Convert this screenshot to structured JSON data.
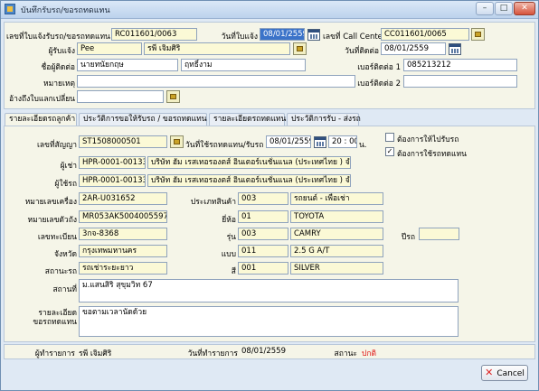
{
  "window": {
    "title": "บันทึกรับรถ/ขอรถทดแทน",
    "minimize_icon": "minimize-icon",
    "maximize_icon": "maximize-icon",
    "close_icon": "close-icon"
  },
  "top": {
    "notice_no_label": "เลขที่ใบแจ้งรับรถ/ขอรถทดแทน",
    "notice_no": "RC011601/0063",
    "notice_date_label": "วันที่ใบแจ้ง",
    "notice_date": "08/01/2559",
    "callcenter_label": "เลขที่ Call Center",
    "callcenter_no": "CC011601/0065",
    "informer_label": "ผู้รับแจ้ง",
    "informer_code": "Pee",
    "informer_name": "รพี เจิมศิริ",
    "contact_date_label": "วันที่ติดต่อ",
    "contact_date": "08/01/2559",
    "contact_name_label": "ชื่อผู้ติดต่อ",
    "contact_title": "นายทนัยกฤษ",
    "contact_lastname": "ฤทธิ์งาม",
    "phone1_label": "เบอร์ติดต่อ 1",
    "phone1": "085213212",
    "remark_label": "หมายเหตุ",
    "remark": "",
    "phone2_label": "เบอร์ติดต่อ 2",
    "phone2": "",
    "ref_label": "อ้างถึงใบแลกเปลี่ยน",
    "ref": ""
  },
  "tabs": [
    {
      "label": "รายละเอียดรถลูกค้า"
    },
    {
      "label": "ประวัติการขอให้รับรถ / ขอรถทดแทน"
    },
    {
      "label": "รายละเอียดรถทดแทน"
    },
    {
      "label": "ประวัติการรับ - ส่งรถ"
    }
  ],
  "detail": {
    "contract_label": "เลขที่สัญญา",
    "contract_no": "ST1508000501",
    "use_date_label": "วันที่ใช้รถทดแทน/รับรถ",
    "use_date": "08/01/2559",
    "hour": "20",
    "minute": "00",
    "time_unit": "น.",
    "chk_pickup_label": "ต้องการให้ไปรับรถ",
    "chk_pickup_mark": "",
    "chk_replace_label": "ต้องการใช้รถทดแทน",
    "chk_replace_mark": "✓",
    "renter_label": "ผู้เช่า",
    "renter_code": "HPR-0001-00133",
    "renter_name": "บริษัท ฮัม เรสเทอรองตส์ อินเตอร์เนชั่นแนล (ประเทศไทย ) จำกัด",
    "user_label": "ผู้ใช้รถ",
    "user_code": "HPR-0001-00133",
    "user_name": "บริษัท ฮัม เรสเทอรองตส์ อินเตอร์เนชั่นแนล (ประเทศไทย ) จำกัด",
    "engine_label": "หมายเลขเครื่อง",
    "engine": "2AR-U031652",
    "type_label": "ประเภทสินค้า",
    "type_code": "003",
    "type_name": "รถยนต์ - เพื่อเช่า",
    "chassis_label": "หมายเลขตัวถัง",
    "chassis": "MR053AK5004005597",
    "brand_label": "ยี่ห้อ",
    "brand_code": "01",
    "brand_name": "TOYOTA",
    "plate_label": "เลขทะเบียน",
    "plate": "3กจ-8368",
    "model_label": "รุ่น",
    "model_code": "003",
    "model_name": "CAMRY",
    "year_label": "ปีรถ",
    "year": "",
    "province_label": "จังหวัด",
    "province": "กรุงเทพมหานคร",
    "style_label": "แบบ",
    "style_code": "011",
    "style_name": "2.5 G A/T",
    "status_label": "สถานะรถ",
    "status": "รถเช่าระยะยาว",
    "color_label": "สี",
    "color_code": "001",
    "color_name": "SILVER",
    "location_label": "สถานที่",
    "location": "ม.แสนสิริ สุขุมวิท 67",
    "request_label_1": "รายละเอียด",
    "request_label_2": "ขอรถทดแทน",
    "request": "ขอตามเวลานัดด้วย"
  },
  "footer": {
    "maker_label": "ผู้ทำรายการ",
    "maker": "รพี เจิมศิริ",
    "made_date_label": "วันที่ทำรายการ",
    "made_date": "08/01/2559",
    "state_label": "สถานะ",
    "state": "ปกติ",
    "cancel_label": "Cancel"
  },
  "colors": {
    "state": "#e01010",
    "selected": "#3b73c9"
  }
}
